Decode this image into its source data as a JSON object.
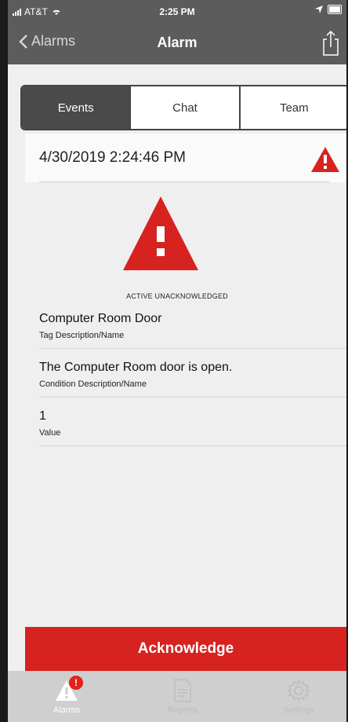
{
  "status_bar": {
    "carrier": "AT&T",
    "time": "2:25 PM"
  },
  "nav": {
    "back_label": "Alarms",
    "title": "Alarm"
  },
  "segments": [
    "Events",
    "Chat",
    "Team"
  ],
  "event": {
    "timestamp": "4/30/2019 2:24:46 PM",
    "state": "ACTIVE UNACKNOWLEDGED"
  },
  "fields": [
    {
      "value": "Computer Room Door",
      "label": "Tag Description/Name"
    },
    {
      "value": "The Computer Room door is open.",
      "label": "Condition Description/Name"
    },
    {
      "value": "1",
      "label": "Value"
    }
  ],
  "acknowledge_label": "Acknowledge",
  "tabbar": {
    "alarms_label": "Alarms",
    "alarms_badge": "!",
    "reports_label": "Reports",
    "settings_label": "Settings"
  },
  "colors": {
    "alert_red": "#d6231f",
    "nav_gray": "#5c5c5c",
    "selected_segment": "#4a4a4a"
  }
}
